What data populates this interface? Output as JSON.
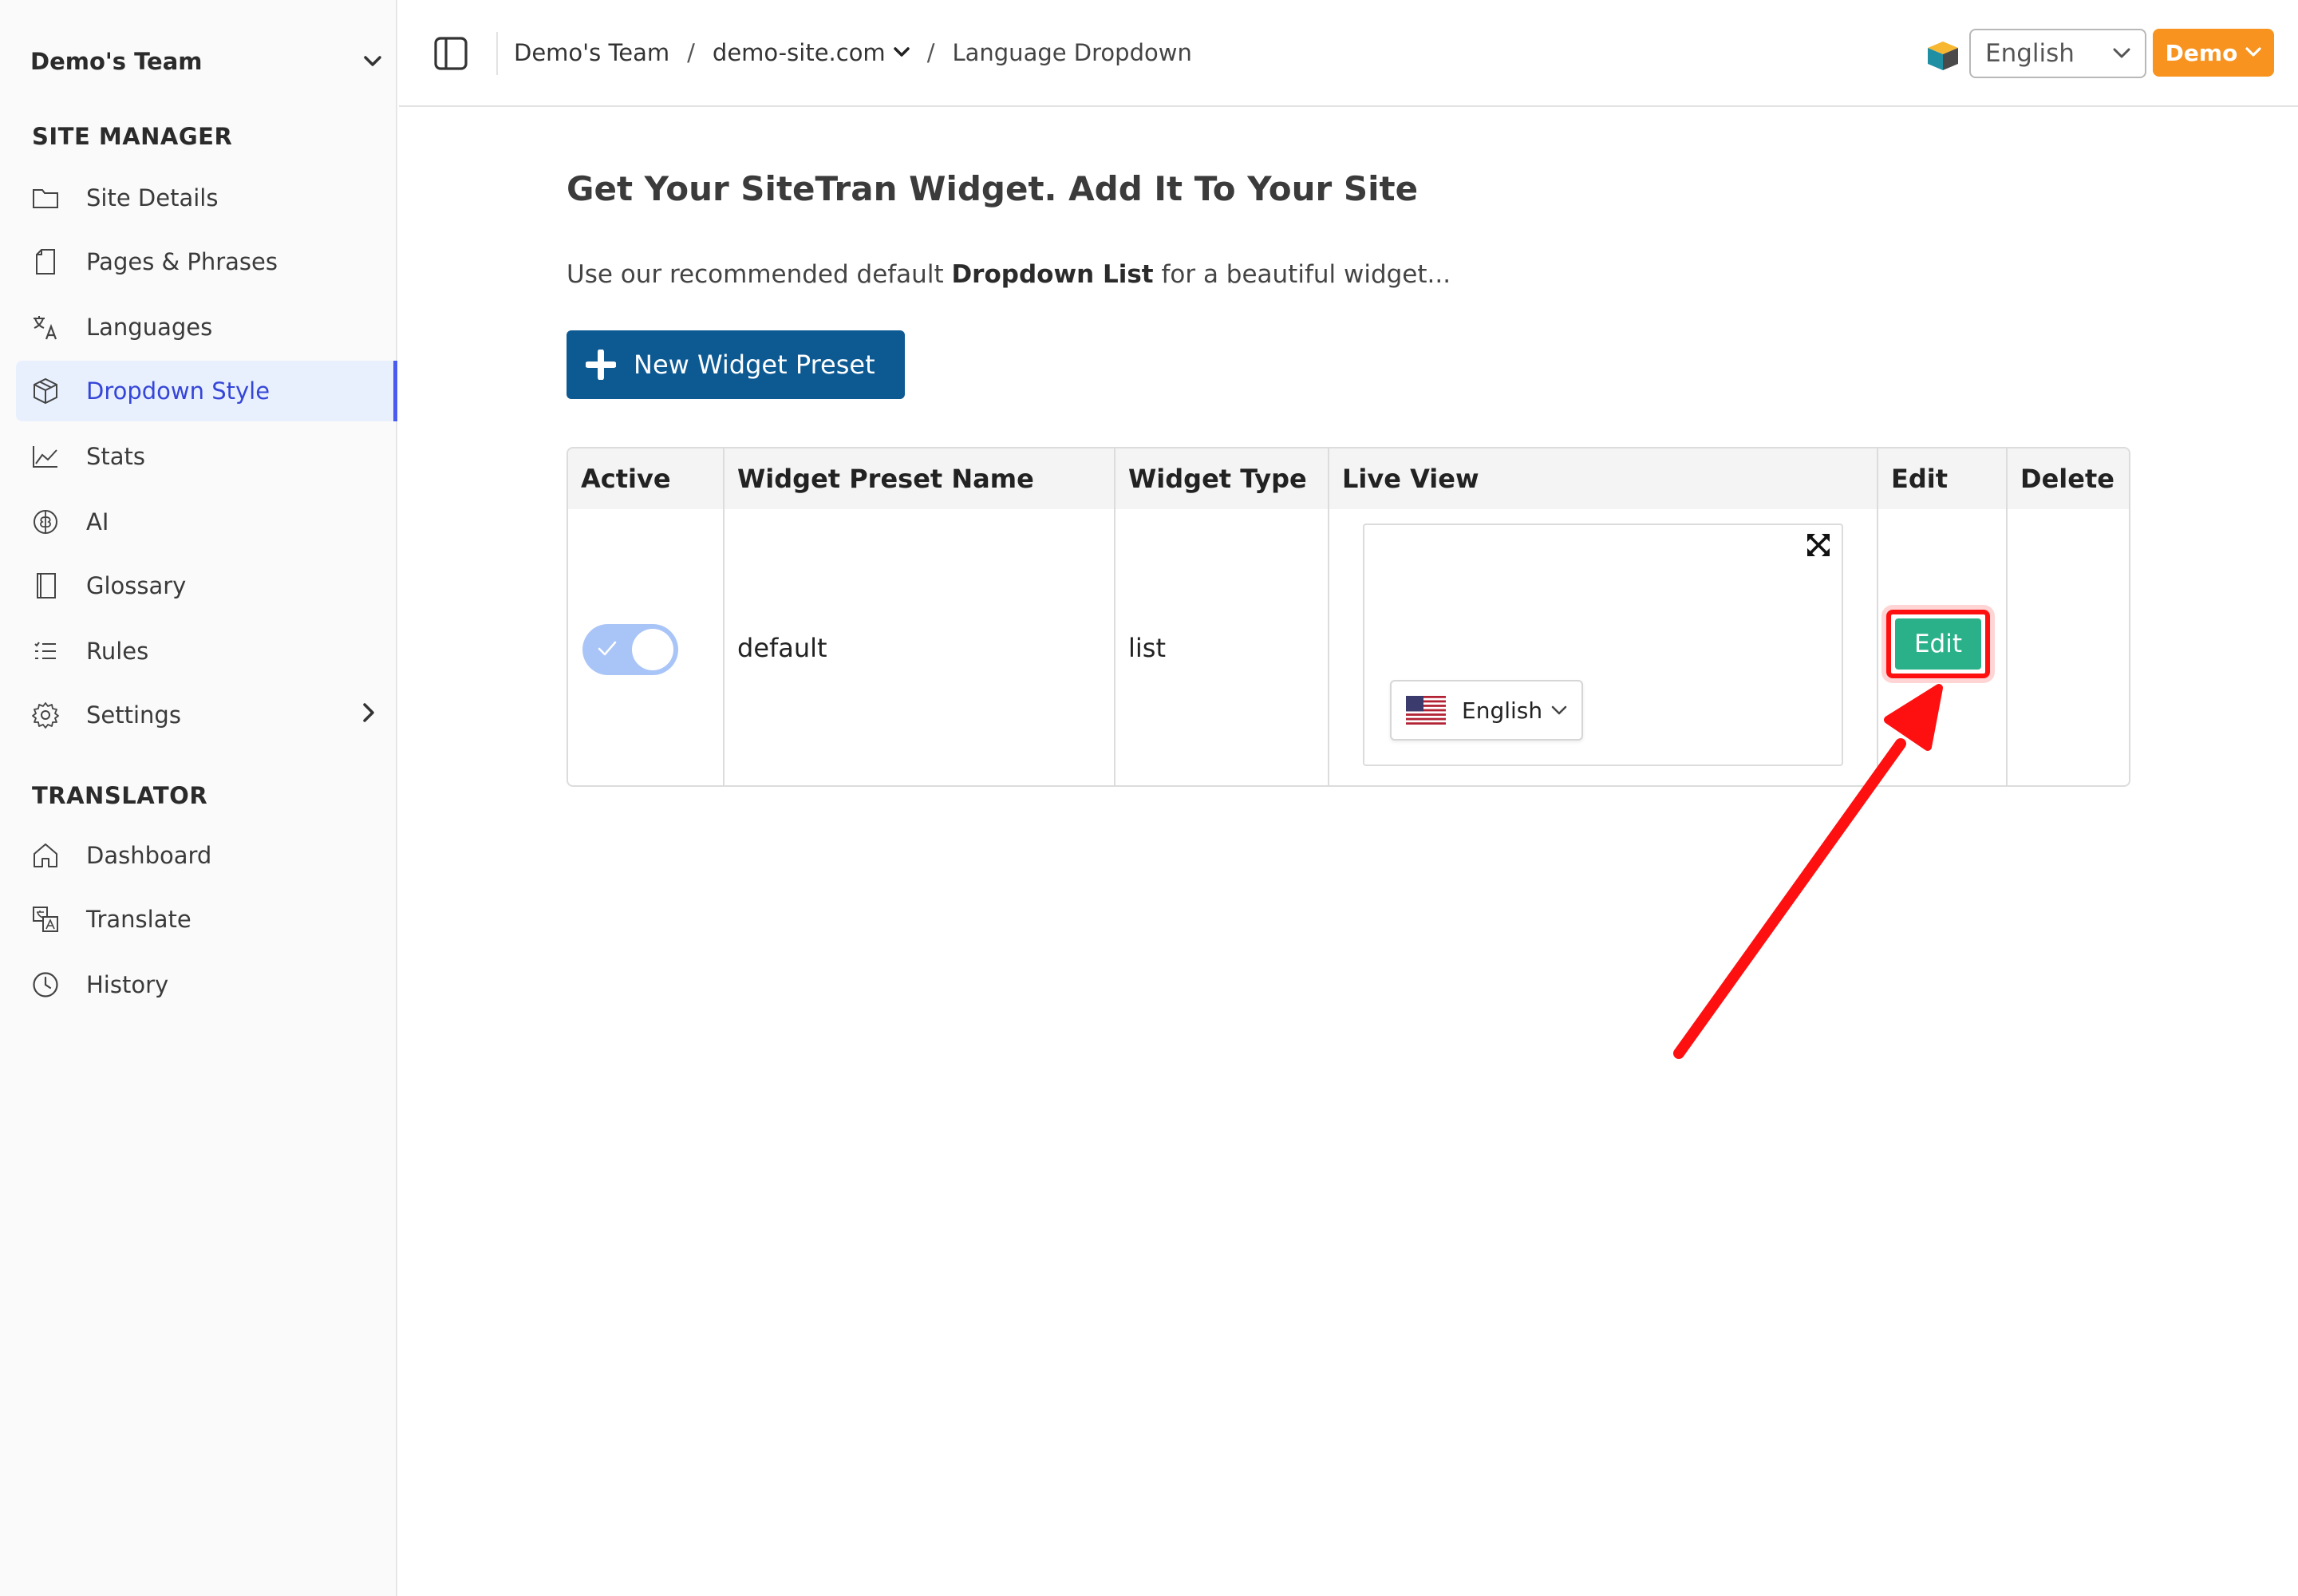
{
  "sidebar": {
    "team_name": "Demo's Team",
    "sections": {
      "site_manager": "SITE MANAGER",
      "translator": "TRANSLATOR"
    },
    "items": [
      {
        "label": "Site Details",
        "icon": "folder-icon"
      },
      {
        "label": "Pages & Phrases",
        "icon": "page-icon"
      },
      {
        "label": "Languages",
        "icon": "translate-icon"
      },
      {
        "label": "Dropdown Style",
        "icon": "cube-icon",
        "active": true
      },
      {
        "label": "Stats",
        "icon": "chart-line-icon"
      },
      {
        "label": "AI",
        "icon": "brain-icon"
      },
      {
        "label": "Glossary",
        "icon": "book-icon"
      },
      {
        "label": "Rules",
        "icon": "list-icon"
      },
      {
        "label": "Settings",
        "icon": "gear-icon"
      },
      {
        "label": "Dashboard",
        "icon": "home-icon"
      },
      {
        "label": "Translate",
        "icon": "translate-doc-icon"
      },
      {
        "label": "History",
        "icon": "clock-icon"
      }
    ]
  },
  "topbar": {
    "breadcrumb": {
      "team": "Demo's Team",
      "site": "demo-site.com",
      "current": "Language Dropdown"
    },
    "language": "English",
    "demo_label": "Demo"
  },
  "main": {
    "title": "Get Your SiteTran Widget. Add It To Your Site",
    "intro_before": "Use our recommended default ",
    "intro_bold": "Dropdown List",
    "intro_after": " for a beautiful widget...",
    "new_preset_label": "New Widget Preset"
  },
  "table": {
    "headers": {
      "active": "Active",
      "name": "Widget Preset Name",
      "type": "Widget Type",
      "live": "Live View",
      "edit": "Edit",
      "delete": "Delete"
    },
    "rows": [
      {
        "active": true,
        "name": "default",
        "type": "list",
        "live_language": "English",
        "edit_label": "Edit"
      }
    ]
  },
  "colors": {
    "accent": "#4a5cf0",
    "primary_button": "#0d5a93",
    "edit_button": "#2bb189",
    "demo_button": "#f7931e",
    "highlight": "#ff1010"
  }
}
